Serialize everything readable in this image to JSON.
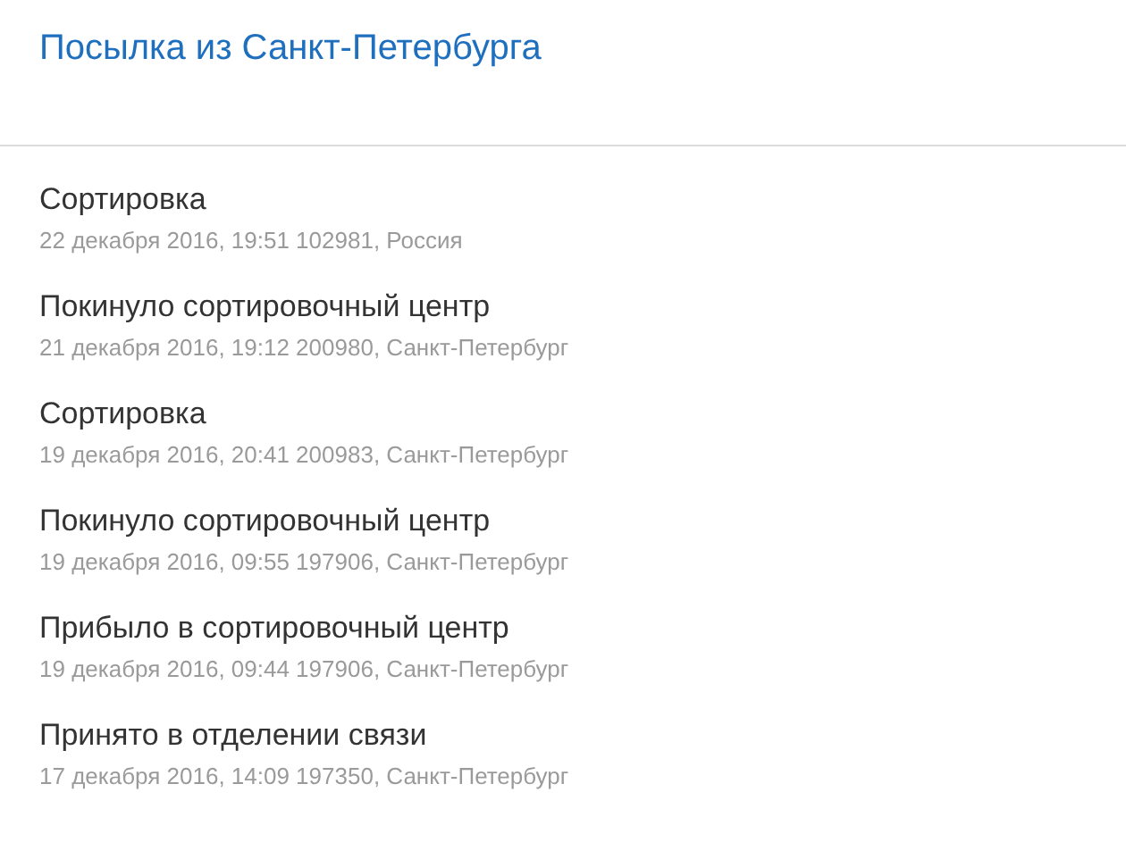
{
  "title": "Посылка из Санкт-Петербурга",
  "events": [
    {
      "status": "Сортировка",
      "details": "22 декабря 2016, 19:51 102981, Россия"
    },
    {
      "status": "Покинуло сортировочный центр",
      "details": "21 декабря 2016, 19:12 200980, Санкт-Петербург"
    },
    {
      "status": "Сортировка",
      "details": "19 декабря 2016, 20:41 200983, Санкт-Петербург"
    },
    {
      "status": "Покинуло сортировочный центр",
      "details": "19 декабря 2016, 09:55 197906, Санкт-Петербург"
    },
    {
      "status": "Прибыло в сортировочный центр",
      "details": "19 декабря 2016, 09:44 197906, Санкт-Петербург"
    },
    {
      "status": "Принято в отделении связи",
      "details": "17 декабря 2016, 14:09 197350, Санкт-Петербург"
    }
  ]
}
